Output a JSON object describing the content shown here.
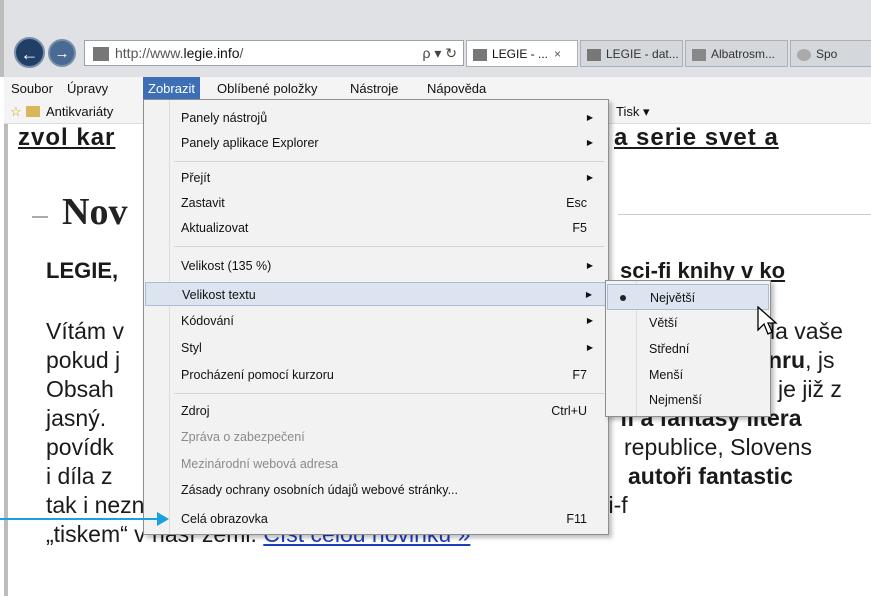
{
  "browser": {
    "url_prefix": "http://www.",
    "url_domain": "legie.info",
    "url_suffix": "/",
    "address_tools": "ρ ▾ ↻",
    "tabs": [
      {
        "label": "LEGIE - ...",
        "close": "×"
      },
      {
        "label": "LEGIE - dat..."
      },
      {
        "label": "Albatrosm..."
      },
      {
        "label": "Spo"
      }
    ]
  },
  "menubar": {
    "items": [
      "Soubor",
      "Úpravy",
      "Zobrazit",
      "Oblíbené položky",
      "Nástroje",
      "Nápověda"
    ]
  },
  "favbar": {
    "item": "Antikvariáty",
    "print": "Tisk ▾"
  },
  "page": {
    "teaser_left": "zvol kar",
    "teaser_right": "a  serie  svet  a",
    "news_heading": "Nov",
    "subhead_left": "LEGIE,",
    "subhead_right": "sci-fi knihy v ko",
    "lines": [
      {
        "left": "Vítám v",
        "right": "la vaše"
      },
      {
        "left": "pokud j",
        "right_bold": "nru",
        "right": ", js"
      },
      {
        "left": "Obsah",
        "right": "je již z"
      },
      {
        "left": "jasný.",
        "right_bold": "fi a fantasy litera"
      },
      {
        "left": "povídk",
        "right": "republice, Slovens"
      },
      {
        "left": "i díla z",
        "right_bold": "autoři fantastic"
      }
    ],
    "line7": "tak i neznámí – všem stačilo jen jedno dílo (fantasy / sci-f",
    "line8_prefix": "„tiskem“ v naší zemi. ",
    "line8_link": "Číst celou novinku »"
  },
  "dropdown": {
    "items": [
      {
        "label": "Panely nástrojů",
        "arrow": "▶"
      },
      {
        "label": "Panely aplikace Explorer",
        "arrow": "▶"
      },
      {
        "label": "Přejít",
        "arrow": "▶"
      },
      {
        "label": "Zastavit",
        "shortcut": "Esc"
      },
      {
        "label": "Aktualizovat",
        "shortcut": "F5"
      },
      {
        "label": "Velikost (135 %)",
        "arrow": "▶"
      },
      {
        "label": "Velikost textu",
        "arrow": "▶"
      },
      {
        "label": "Kódování",
        "arrow": "▶"
      },
      {
        "label": "Styl",
        "arrow": "▶"
      },
      {
        "label": "Procházení pomocí kurzoru",
        "shortcut": "F7"
      },
      {
        "label": "Zdroj",
        "shortcut": "Ctrl+U"
      },
      {
        "label": "Zpráva o zabezpečení"
      },
      {
        "label": "Mezinárodní webová adresa"
      },
      {
        "label": "Zásady ochrany osobních údajů webové stránky..."
      },
      {
        "label": "Celá obrazovka",
        "shortcut": "F11"
      }
    ]
  },
  "submenu": {
    "items": [
      "Největší",
      "Větší",
      "Střední",
      "Menší",
      "Nejmenší"
    ]
  },
  "colors": {
    "menu_highlight": "#3d6fb6",
    "callout": "#1aa0e0"
  }
}
